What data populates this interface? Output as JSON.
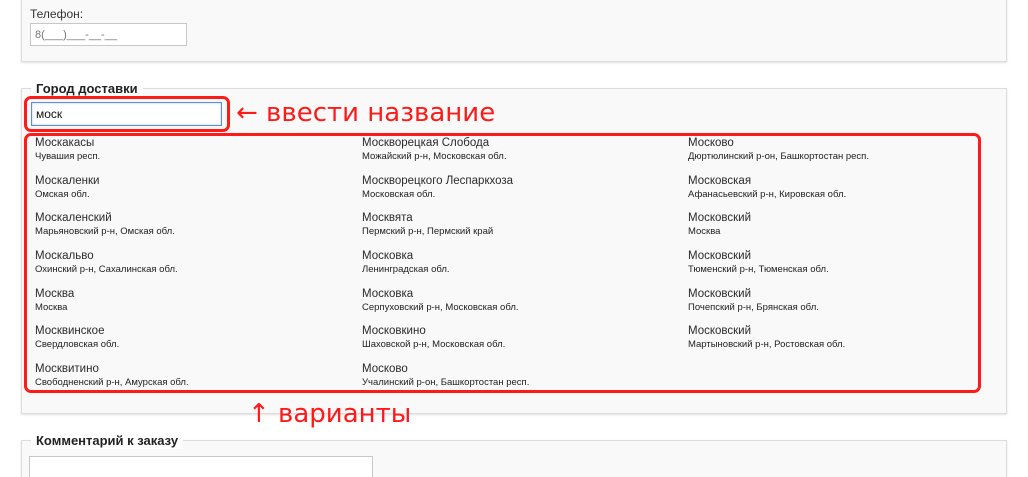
{
  "phone": {
    "label": "Телефон:",
    "placeholder": "8(___)___-__-__"
  },
  "city": {
    "legend": "Город доставки",
    "input_value": "моск",
    "columns": [
      [
        {
          "name": "Москакасы",
          "region": "Чувашия респ."
        },
        {
          "name": "Москаленки",
          "region": "Омская обл."
        },
        {
          "name": "Москаленский",
          "region": "Марьяновский р-н, Омская обл."
        },
        {
          "name": "Москальво",
          "region": "Охинский р-н, Сахалинская обл."
        },
        {
          "name": "Москва",
          "region": "Москва"
        },
        {
          "name": "Москвинское",
          "region": "Свердловская обл."
        },
        {
          "name": "Москвитино",
          "region": "Свободненский р-н, Амурская обл."
        }
      ],
      [
        {
          "name": "Москворецкая Слобода",
          "region": "Можайский р-н, Московская обл."
        },
        {
          "name": "Москворецкого Леспаркхоза",
          "region": "Московская обл."
        },
        {
          "name": "Москвята",
          "region": "Пермский р-н, Пермский край"
        },
        {
          "name": "Московка",
          "region": "Ленинградская обл."
        },
        {
          "name": "Московка",
          "region": "Серпуховский р-н, Московская обл."
        },
        {
          "name": "Московкино",
          "region": "Шаховской р-н, Московская обл."
        },
        {
          "name": "Москово",
          "region": "Учалинский р-он, Башкортостан респ."
        }
      ],
      [
        {
          "name": "Москово",
          "region": "Дюртюлинский р-он, Башкортостан респ."
        },
        {
          "name": "Московская",
          "region": "Афанасьевский р-н, Кировская обл."
        },
        {
          "name": "Московский",
          "region": "Москва"
        },
        {
          "name": "Московский",
          "region": "Тюменский р-н, Тюменская обл."
        },
        {
          "name": "Московский",
          "region": "Почепский р-н, Брянская обл."
        },
        {
          "name": "Московский",
          "region": "Мартыновский р-н, Ростовская обл."
        }
      ]
    ]
  },
  "annotations": {
    "input_hint": "← ввести название",
    "options_hint": "↑ варианты",
    "color": "#ff1a1a"
  },
  "comment": {
    "legend": "Комментарий к заказу"
  }
}
